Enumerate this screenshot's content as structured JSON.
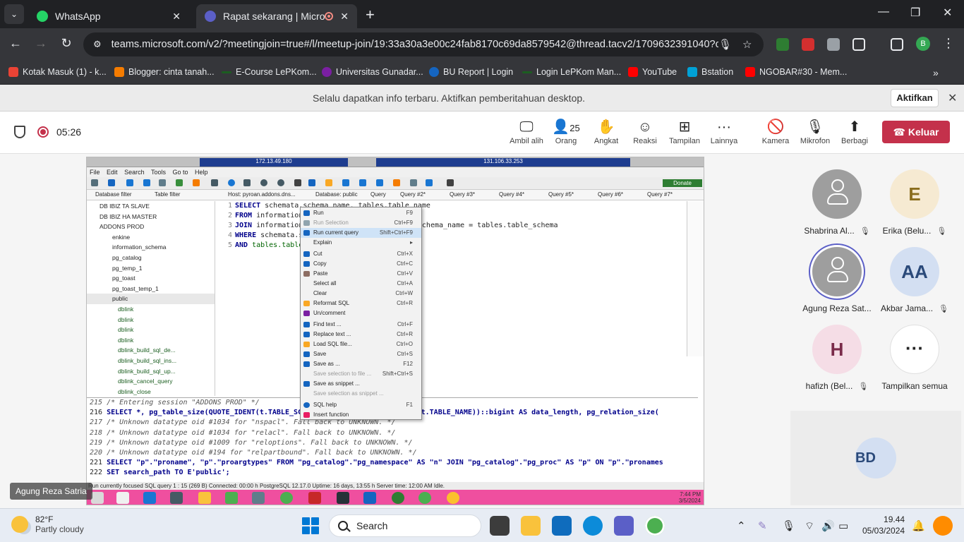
{
  "browser": {
    "tabs": [
      {
        "title": "WhatsApp",
        "active": false
      },
      {
        "title": "Rapat sekarang | Microsoft",
        "active": true
      }
    ],
    "url": "teams.microsoft.com/v2/?meetingjoin=true#/l/meetup-join/19:33a30a3e00c24fab8170c69da8579542@thread.tacv2/1709632391040?co...",
    "profile_initial": "B",
    "bookmarks": [
      {
        "label": "Kotak Masuk (1) - k...",
        "color": "#ea4335"
      },
      {
        "label": "Blogger: cinta tanah...",
        "color": "#f57c00"
      },
      {
        "label": "E-Course LePKom...",
        "color": "#1b5e20"
      },
      {
        "label": "Universitas Gunadar...",
        "color": "#7b1fa2"
      },
      {
        "label": "BU Report | Login",
        "color": "#1565c0"
      },
      {
        "label": "Login LePKom Man...",
        "color": "#1b5e20"
      },
      {
        "label": "YouTube",
        "color": "#ff0000"
      },
      {
        "label": "Bstation",
        "color": "#00a1d6"
      },
      {
        "label": "NGOBAR#30 - Mem...",
        "color": "#ff0000"
      }
    ]
  },
  "banner": {
    "message": "Selalu dapatkan info terbaru. Aktifkan pemberitahuan desktop.",
    "button": "Aktifkan"
  },
  "meeting": {
    "timer": "05:26",
    "controls": {
      "take_control": "Ambil alih",
      "people": "Orang",
      "people_count": "25",
      "raise": "Angkat",
      "react": "Reaksi",
      "view": "Tampilan",
      "more": "Lainnya",
      "camera": "Kamera",
      "mic": "Mikrofon",
      "share": "Berbagi"
    },
    "leave": "Keluar",
    "presenter": "Agung Reza Satria"
  },
  "shared": {
    "rdp_title_left": "172.13.49.180",
    "rdp_title_right": "131.106.33.253",
    "menu": [
      "File",
      "Edit",
      "Search",
      "Tools",
      "Go to",
      "Help"
    ],
    "donate": "Donate",
    "tabs": [
      "Database filter",
      "Table filter",
      "Host: pyroan.addons.dns...",
      "Database: public",
      "Query",
      "Query #2*",
      "Query #3*",
      "Query #4*",
      "Query #5*",
      "Query #6*",
      "Query #7*"
    ],
    "tree": [
      "DB IBIZ TA SLAVE",
      "DB IBIZ HA MASTER",
      "ADDONS PROD",
      "enkine",
      "information_schema",
      "pg_catalog",
      "pg_temp_1",
      "pg_toast",
      "pg_toast_temp_1",
      "public",
      "dblink",
      "dblink",
      "dblink",
      "dblink",
      "dblink_build_sql_de...",
      "dblink_build_sql_ins...",
      "dblink_build_sql_up...",
      "dblink_cancel_query",
      "dblink_close"
    ],
    "editor_lines": [
      {
        "n": "1",
        "kw": "SELECT",
        "rest": " schemata.schema_name, tables.table_name"
      },
      {
        "n": "2",
        "kw": "FROM",
        "rest": " information_schema.schemata"
      },
      {
        "n": "3",
        "kw": "JOIN",
        "rest": " information_schema.tables ON schemata.schema_name = tables.table_schema"
      },
      {
        "n": "4",
        "kw": "WHERE",
        "rest": " schemata.schema_name ..."
      },
      {
        "n": "5",
        "kw": "AND",
        "rest": " tables.table_name ... 'reports');"
      }
    ],
    "context_menu": [
      {
        "label": "Run",
        "key": "F9",
        "dis": false,
        "hl": false,
        "color": "#1565c0"
      },
      {
        "label": "Run Selection",
        "key": "Ctrl+F9",
        "dis": true,
        "hl": false,
        "color": "#90a4ae"
      },
      {
        "label": "Run current query",
        "key": "Shift+Ctrl+F9",
        "dis": false,
        "hl": true,
        "color": "#1565c0"
      },
      {
        "label": "Explain",
        "key": "",
        "dis": false,
        "hl": false,
        "color": ""
      },
      {
        "label": "Cut",
        "key": "Ctrl+X",
        "dis": false,
        "hl": false,
        "color": "#1565c0"
      },
      {
        "label": "Copy",
        "key": "Ctrl+C",
        "dis": false,
        "hl": false,
        "color": "#1565c0"
      },
      {
        "label": "Paste",
        "key": "Ctrl+V",
        "dis": false,
        "hl": false,
        "color": "#8d6e63"
      },
      {
        "label": "Select all",
        "key": "Ctrl+A",
        "dis": false,
        "hl": false,
        "color": ""
      },
      {
        "label": "Clear",
        "key": "Ctrl+W",
        "dis": false,
        "hl": false,
        "color": ""
      },
      {
        "label": "Reformat SQL",
        "key": "Ctrl+R",
        "dis": false,
        "hl": false,
        "color": "#f9a825"
      },
      {
        "label": "Un/comment",
        "key": "",
        "dis": false,
        "hl": false,
        "color": "#7b1fa2"
      },
      {
        "label": "Find text ...",
        "key": "Ctrl+F",
        "dis": false,
        "hl": false,
        "color": "#1565c0"
      },
      {
        "label": "Replace text ...",
        "key": "Ctrl+R",
        "dis": false,
        "hl": false,
        "color": "#1565c0"
      },
      {
        "label": "Load SQL file...",
        "key": "Ctrl+O",
        "dis": false,
        "hl": false,
        "color": "#f9a825"
      },
      {
        "label": "Save",
        "key": "Ctrl+S",
        "dis": false,
        "hl": false,
        "color": "#1565c0"
      },
      {
        "label": "Save as ...",
        "key": "F12",
        "dis": false,
        "hl": false,
        "color": "#1565c0"
      },
      {
        "label": "Save selection to file ...",
        "key": "Shift+Ctrl+S",
        "dis": true,
        "hl": false,
        "color": ""
      },
      {
        "label": "Save as snippet ...",
        "key": "",
        "dis": false,
        "hl": false,
        "color": "#1565c0"
      },
      {
        "label": "Save selection as snippet ...",
        "key": "",
        "dis": true,
        "hl": false,
        "color": ""
      },
      {
        "label": "SQL help",
        "key": "F1",
        "dis": false,
        "hl": false,
        "color": "#1565c0"
      },
      {
        "label": "Insert function",
        "key": "",
        "dis": false,
        "hl": false,
        "color": "#e91e63"
      }
    ],
    "output_lines": [
      {
        "n": "215",
        "text": "/* Entering session \"ADDONS PROD\" */",
        "c": true
      },
      {
        "n": "216",
        "text": "SELECT *, pg_table_size(QUOTE_IDENT(t.TABLE_SCHEMA) || '.' || QUOTE_IDENT(t.TABLE_NAME))::bigint AS data_length, pg_relation_size(",
        "c": false
      },
      {
        "n": "217",
        "text": "/* Unknown datatype oid #1034 for \"nspacl\". Fall back to UNKNOWN. */",
        "c": true
      },
      {
        "n": "218",
        "text": "/* Unknown datatype oid #1034 for \"relacl\". Fall back to UNKNOWN. */",
        "c": true
      },
      {
        "n": "219",
        "text": "/* Unknown datatype oid #1009 for \"reloptions\". Fall back to UNKNOWN. */",
        "c": true
      },
      {
        "n": "220",
        "text": "/* Unknown datatype oid #194 for \"relpartbound\". Fall back to UNKNOWN. */",
        "c": true
      },
      {
        "n": "221",
        "text": "SELECT \"p\".\"proname\", \"p\".\"proargtypes\" FROM \"pg_catalog\".\"pg_namespace\" AS \"n\" JOIN \"pg_catalog\".\"pg_proc\" AS \"p\" ON \"p\".\"pronames",
        "c": false
      },
      {
        "n": "222",
        "text": "SET search_path TO E'public';",
        "c": false
      }
    ],
    "status": "Run currently focused SQL query        1 : 15 (269 B)        Connected: 00:00 h        PostgreSQL 12.17.0        Uptime: 16 days, 13:55 h        Server time: 12:00 AM        Idle.",
    "clock_time": "7:44 PM",
    "clock_date": "3/5/2024"
  },
  "participants": [
    {
      "name": "Shabrina Al...",
      "initials": "",
      "bg": "#9e9e9e",
      "ring": false
    },
    {
      "name": "Erika (Belu...",
      "initials": "E",
      "bg": "#f6ead2",
      "color": "#8a6d1d",
      "ring": false
    },
    {
      "name": "Agung Reza Sat...",
      "initials": "",
      "bg": "#9e9e9e",
      "ring": true
    },
    {
      "name": "Akbar Jama...",
      "initials": "AA",
      "bg": "#d3dff2",
      "color": "#2b4a7a",
      "ring": false
    },
    {
      "name": "hafizh (Bel...",
      "initials": "H",
      "bg": "#f5dde6",
      "color": "#7a2b4a",
      "ring": false
    },
    {
      "name": "Tampilkan semua",
      "initials": "···",
      "bg": "#ffffff",
      "color": "#242424",
      "ring": false
    }
  ],
  "bd_tile": {
    "initials": "BD"
  },
  "windows": {
    "temp": "82°F",
    "condition": "Partly cloudy",
    "search": "Search",
    "time": "19.44",
    "date": "05/03/2024"
  }
}
